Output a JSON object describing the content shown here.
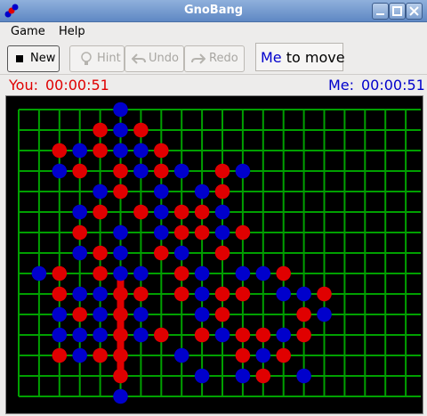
{
  "window": {
    "title": "GnoBang"
  },
  "menu": {
    "game": "Game",
    "help": "Help"
  },
  "toolbar": {
    "new": "New",
    "hint": "Hint",
    "undo": "Undo",
    "redo": "Redo"
  },
  "status": {
    "who": "Me",
    "rest": " to move"
  },
  "timers": {
    "you_label": "You:",
    "you_time": "00:00:51",
    "me_label": "Me:",
    "me_time": "00:00:51"
  },
  "colors": {
    "grid": "#00a000",
    "red": "#e00000",
    "blue": "#0000cc",
    "board_bg": "#000000"
  },
  "board": {
    "cols": 20,
    "rows": 14,
    "stones": [
      [
        "b",
        5,
        0
      ],
      [
        "r",
        4,
        1
      ],
      [
        "b",
        5,
        1
      ],
      [
        "r",
        6,
        1
      ],
      [
        "r",
        2,
        2
      ],
      [
        "b",
        3,
        2
      ],
      [
        "r",
        4,
        2
      ],
      [
        "b",
        5,
        2
      ],
      [
        "b",
        6,
        2
      ],
      [
        "r",
        7,
        2
      ],
      [
        "b",
        2,
        3
      ],
      [
        "r",
        3,
        3
      ],
      [
        "r",
        5,
        3
      ],
      [
        "b",
        6,
        3
      ],
      [
        "r",
        7,
        3
      ],
      [
        "b",
        8,
        3
      ],
      [
        "r",
        10,
        3
      ],
      [
        "b",
        11,
        3
      ],
      [
        "b",
        4,
        4
      ],
      [
        "r",
        5,
        4
      ],
      [
        "b",
        7,
        4
      ],
      [
        "b",
        9,
        4
      ],
      [
        "r",
        10,
        4
      ],
      [
        "b",
        3,
        5
      ],
      [
        "r",
        4,
        5
      ],
      [
        "r",
        6,
        5
      ],
      [
        "b",
        7,
        5
      ],
      [
        "r",
        8,
        5
      ],
      [
        "r",
        9,
        5
      ],
      [
        "b",
        10,
        5
      ],
      [
        "r",
        3,
        6
      ],
      [
        "b",
        5,
        6
      ],
      [
        "b",
        7,
        6
      ],
      [
        "r",
        8,
        6
      ],
      [
        "r",
        9,
        6
      ],
      [
        "b",
        10,
        6
      ],
      [
        "r",
        11,
        6
      ],
      [
        "b",
        3,
        7
      ],
      [
        "r",
        4,
        7
      ],
      [
        "b",
        5,
        7
      ],
      [
        "r",
        7,
        7
      ],
      [
        "b",
        8,
        7
      ],
      [
        "r",
        10,
        7
      ],
      [
        "b",
        1,
        8
      ],
      [
        "r",
        2,
        8
      ],
      [
        "r",
        4,
        8
      ],
      [
        "b",
        5,
        8
      ],
      [
        "b",
        6,
        8
      ],
      [
        "r",
        8,
        8
      ],
      [
        "b",
        9,
        8
      ],
      [
        "b",
        11,
        8
      ],
      [
        "b",
        12,
        8
      ],
      [
        "r",
        13,
        8
      ],
      [
        "r",
        2,
        9
      ],
      [
        "b",
        3,
        9
      ],
      [
        "b",
        4,
        9
      ],
      [
        "r",
        5,
        9
      ],
      [
        "r",
        6,
        9
      ],
      [
        "r",
        8,
        9
      ],
      [
        "b",
        9,
        9
      ],
      [
        "r",
        10,
        9
      ],
      [
        "r",
        11,
        9
      ],
      [
        "b",
        13,
        9
      ],
      [
        "b",
        14,
        9
      ],
      [
        "r",
        15,
        9
      ],
      [
        "b",
        2,
        10
      ],
      [
        "r",
        3,
        10
      ],
      [
        "b",
        4,
        10
      ],
      [
        "r",
        5,
        10
      ],
      [
        "b",
        6,
        10
      ],
      [
        "b",
        9,
        10
      ],
      [
        "r",
        10,
        10
      ],
      [
        "r",
        14,
        10
      ],
      [
        "b",
        15,
        10
      ],
      [
        "b",
        2,
        11
      ],
      [
        "b",
        3,
        11
      ],
      [
        "b",
        4,
        11
      ],
      [
        "r",
        5,
        11
      ],
      [
        "b",
        6,
        11
      ],
      [
        "r",
        7,
        11
      ],
      [
        "r",
        9,
        11
      ],
      [
        "b",
        10,
        11
      ],
      [
        "r",
        11,
        11
      ],
      [
        "r",
        12,
        11
      ],
      [
        "b",
        13,
        11
      ],
      [
        "r",
        14,
        11
      ],
      [
        "r",
        2,
        12
      ],
      [
        "b",
        3,
        12
      ],
      [
        "r",
        4,
        12
      ],
      [
        "r",
        5,
        12
      ],
      [
        "b",
        8,
        12
      ],
      [
        "r",
        11,
        12
      ],
      [
        "b",
        12,
        12
      ],
      [
        "r",
        13,
        12
      ],
      [
        "r",
        5,
        13
      ],
      [
        "b",
        9,
        13
      ],
      [
        "b",
        11,
        13
      ],
      [
        "r",
        12,
        13
      ],
      [
        "b",
        14,
        13
      ],
      [
        "b",
        5,
        14
      ]
    ],
    "highlight_line": {
      "col": 5,
      "from_row": 8,
      "to_row": 13
    }
  }
}
